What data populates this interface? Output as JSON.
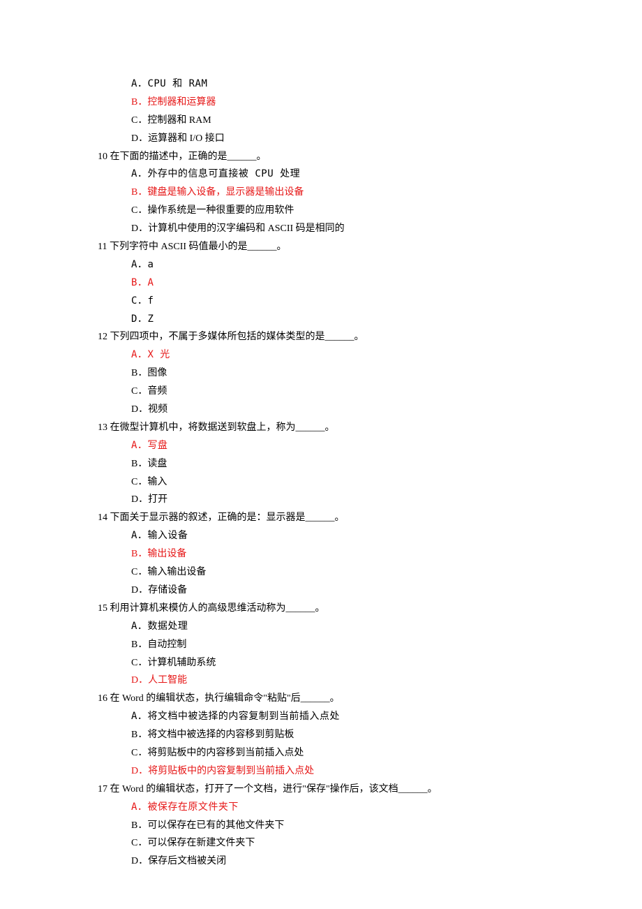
{
  "blank": "______",
  "questions": [
    {
      "num": "",
      "text": "",
      "options": [
        {
          "label": "A．",
          "text": "CPU 和 RAM",
          "mono": true,
          "correct": false
        },
        {
          "label": "B．",
          "text": "控制器和运算器",
          "correct": true
        },
        {
          "label": "C．",
          "text": "控制器和 RAM",
          "correct": false
        },
        {
          "label": "D．",
          "text": "运算器和 I/O 接口",
          "correct": false
        }
      ]
    },
    {
      "num": "10",
      "text": "在下面的描述中，正确的是______。",
      "options": [
        {
          "label": "A．",
          "text": "外存中的信息可直接被 CPU 处理",
          "mono": true,
          "correct": false
        },
        {
          "label": "B．",
          "text": "键盘是输入设备，显示器是输出设备",
          "correct": true
        },
        {
          "label": "C．",
          "text": "操作系统是一种很重要的应用软件",
          "correct": false
        },
        {
          "label": "D．",
          "text": "计算机中使用的汉字编码和 ASCII 码是相同的",
          "correct": false
        }
      ]
    },
    {
      "num": "11",
      "text": "下列字符中 ASCII 码值最小的是______。",
      "options": [
        {
          "label": "A．",
          "text": "a",
          "mono": true,
          "correct": false
        },
        {
          "label": "B．",
          "text": "A",
          "mono": true,
          "correct": true
        },
        {
          "label": "C．",
          "text": "f",
          "mono": true,
          "correct": false
        },
        {
          "label": "D．",
          "text": "Z",
          "mono": true,
          "correct": false
        }
      ]
    },
    {
      "num": "12",
      "text": "下列四项中，不属于多媒体所包括的媒体类型的是______。",
      "options": [
        {
          "label": "A．",
          "text": "X 光",
          "mono": true,
          "correct": true
        },
        {
          "label": "B．",
          "text": "图像",
          "correct": false
        },
        {
          "label": "C．",
          "text": "音频",
          "correct": false
        },
        {
          "label": "D．",
          "text": "视频",
          "correct": false
        }
      ]
    },
    {
      "num": "13",
      "text": "在微型计算机中，将数据送到软盘上，称为______。",
      "options": [
        {
          "label": "A．",
          "text": "写盘",
          "mono": true,
          "correct": true
        },
        {
          "label": "B．",
          "text": "读盘",
          "correct": false
        },
        {
          "label": "C．",
          "text": "输入",
          "correct": false
        },
        {
          "label": "D．",
          "text": "打开",
          "correct": false
        }
      ]
    },
    {
      "num": "14",
      "text": "下面关于显示器的叙述，正确的是：显示器是______。",
      "options": [
        {
          "label": "A．",
          "text": "输入设备",
          "mono": true,
          "correct": false
        },
        {
          "label": "B．",
          "text": "输出设备",
          "correct": true
        },
        {
          "label": "C．",
          "text": "输入输出设备",
          "correct": false
        },
        {
          "label": "D．",
          "text": "存储设备",
          "correct": false
        }
      ]
    },
    {
      "num": "15",
      "text": "利用计算机来模仿人的高级思维活动称为______。",
      "options": [
        {
          "label": "A．",
          "text": "数据处理",
          "mono": true,
          "correct": false
        },
        {
          "label": "B．",
          "text": "自动控制",
          "correct": false
        },
        {
          "label": "C．",
          "text": "计算机辅助系统",
          "correct": false
        },
        {
          "label": "D．",
          "text": "人工智能",
          "correct": true
        }
      ]
    },
    {
      "num": "16",
      "text": "在 Word 的编辑状态，执行编辑命令\"粘贴\"后______。",
      "options": [
        {
          "label": "A．",
          "text": "将文档中被选择的内容复制到当前插入点处",
          "mono": true,
          "correct": false
        },
        {
          "label": "B．",
          "text": "将文档中被选择的内容移到剪贴板",
          "correct": false
        },
        {
          "label": "C．",
          "text": "将剪贴板中的内容移到当前插入点处",
          "correct": false
        },
        {
          "label": "D．",
          "text": "将剪贴板中的内容复制到当前插入点处",
          "correct": true
        }
      ]
    },
    {
      "num": "17",
      "text": "在 Word 的编辑状态，打开了一个文档，进行\"保存\"操作后，该文档______。",
      "options": [
        {
          "label": "A．",
          "text": "被保存在原文件夹下",
          "mono": true,
          "correct": true
        },
        {
          "label": "B．",
          "text": "可以保存在已有的其他文件夹下",
          "correct": false
        },
        {
          "label": "C．",
          "text": "可以保存在新建文件夹下",
          "correct": false
        },
        {
          "label": "D．",
          "text": "保存后文档被关闭",
          "correct": false
        }
      ]
    }
  ]
}
